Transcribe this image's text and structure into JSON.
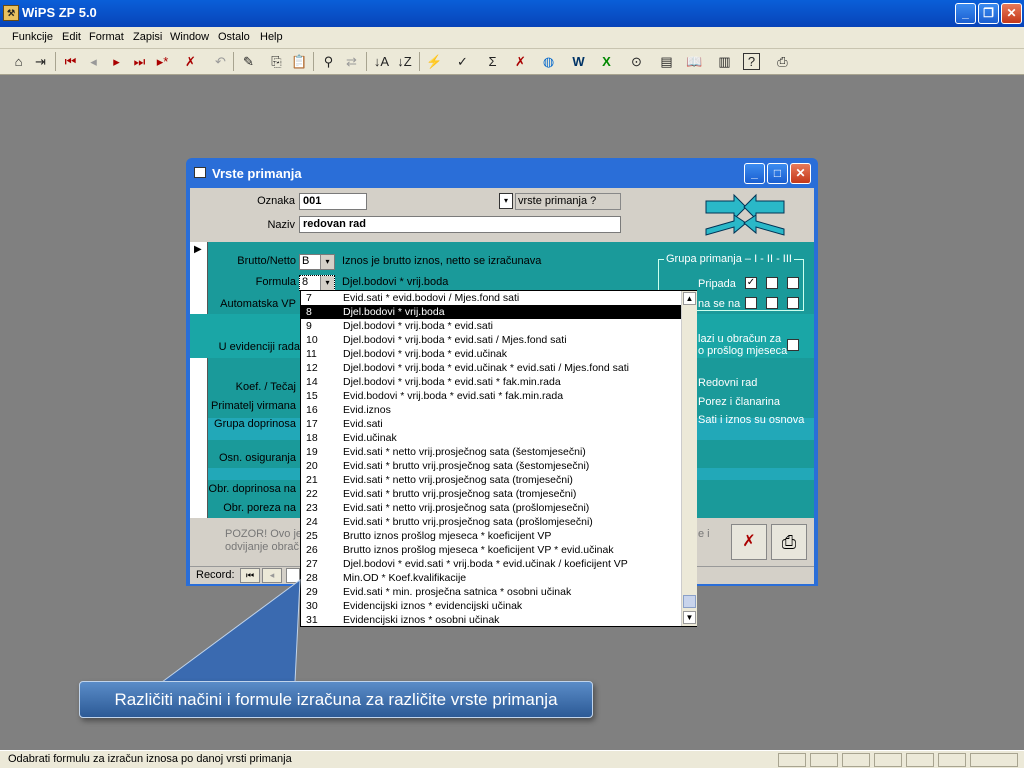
{
  "app": {
    "title": "WiPS ZP 5.0"
  },
  "menu": [
    "Funkcije",
    "Edit",
    "Format",
    "Zapisi",
    "Window",
    "Ostalo",
    "Help"
  ],
  "form": {
    "title": "Vrste primanja",
    "oznaka_label": "Oznaka",
    "oznaka_value": "001",
    "naziv_label": "Naziv",
    "naziv_value": "redovan rad",
    "lookup_text": "vrste primanja ?",
    "brutto_label": "Brutto/Netto",
    "brutto_value": "B",
    "brutto_desc": "Iznos je brutto iznos, netto se izračunava",
    "formula_label": "Formula",
    "formula_value": "8",
    "formula_desc": "Djel.bodovi * vrij.boda",
    "automatska_label": "Automatska VP",
    "evidencija_label": "U evidenciji rada",
    "koef_label": "Koef. / Tečaj",
    "primatelj_label": "Primatelj virmana",
    "grupa_doprinosa_label": "Grupa doprinosa",
    "osn_label": "Osn. osiguranja",
    "obr_doprinosa_label": "Obr. doprinosa na",
    "obr_poreza_label": "Obr. poreza na",
    "grupa_primanja_label": "Grupa primanja",
    "grupa_cols": "I  -  II  -  III",
    "pripada_label": "Pripada",
    "ulazi_label": "na se na",
    "ulazi_text": "lazi u obračun za",
    "ulazi_text2": "o prošlog mjeseca",
    "redovni_rad": "Redovni rad",
    "porez_clanarina": "Porez i članarina",
    "sati_iznos": "Sati i iznos su osnova",
    "pozor_text": "POZOR! Ovo je",
    "pozor_text2": "odvijanje obrač",
    "pozor_right": "e i",
    "record_label": "Record:"
  },
  "dropdown": [
    {
      "n": "7",
      "t": "Evid.sati * evid.bodovi / Mjes.fond sati"
    },
    {
      "n": "8",
      "t": "Djel.bodovi * vrij.boda"
    },
    {
      "n": "9",
      "t": "Djel.bodovi * vrij.boda * evid.sati"
    },
    {
      "n": "10",
      "t": "Djel.bodovi * vrij.boda * evid.sati / Mjes.fond sati"
    },
    {
      "n": "11",
      "t": "Djel.bodovi * vrij.boda * evid.učinak"
    },
    {
      "n": "12",
      "t": "Djel.bodovi * vrij.boda * evid.učinak * evid.sati / Mjes.fond sati"
    },
    {
      "n": "14",
      "t": "Djel.bodovi * vrij.boda * evid.sati * fak.min.rada"
    },
    {
      "n": "15",
      "t": "Evid.bodovi * vrij.boda * evid.sati * fak.min.rada"
    },
    {
      "n": "16",
      "t": "Evid.iznos"
    },
    {
      "n": "17",
      "t": "Evid.sati"
    },
    {
      "n": "18",
      "t": "Evid.učinak"
    },
    {
      "n": "19",
      "t": "Evid.sati * netto vrij.prosječnog sata (šestomjesečni)"
    },
    {
      "n": "20",
      "t": "Evid.sati * brutto vrij.prosječnog sata (šestomjesečni)"
    },
    {
      "n": "21",
      "t": "Evid.sati * netto vrij.prosječnog sata (tromjesečni)"
    },
    {
      "n": "22",
      "t": "Evid.sati * brutto vrij.prosječnog sata (tromjesečni)"
    },
    {
      "n": "23",
      "t": "Evid.sati * netto vrij.prosječnog sata (prošlomjesečni)"
    },
    {
      "n": "24",
      "t": "Evid.sati * brutto vrij.prosječnog sata (prošlomjesečni)"
    },
    {
      "n": "25",
      "t": "Brutto iznos prošlog mjeseca * koeficijent VP"
    },
    {
      "n": "26",
      "t": "Brutto iznos prošlog mjeseca * koeficijent VP * evid.učinak"
    },
    {
      "n": "27",
      "t": "Djel.bodovi * evid.sati * vrij.boda * evid.učinak / koeficijent VP"
    },
    {
      "n": "28",
      "t": "Min.OD * Koef.kvalifikacije"
    },
    {
      "n": "29",
      "t": "Evid.sati * min. prosječna satnica * osobni učinak"
    },
    {
      "n": "30",
      "t": "Evidencijski iznos * evidencijski učinak"
    },
    {
      "n": "31",
      "t": "Evidencijski iznos * osobni učinak"
    }
  ],
  "dropdown_selected": "8",
  "callout": "Različiti načini i formule izračuna za različite vrste primanja",
  "status": "Odabrati formulu za izračun iznosa po danoj vrsti primanja"
}
